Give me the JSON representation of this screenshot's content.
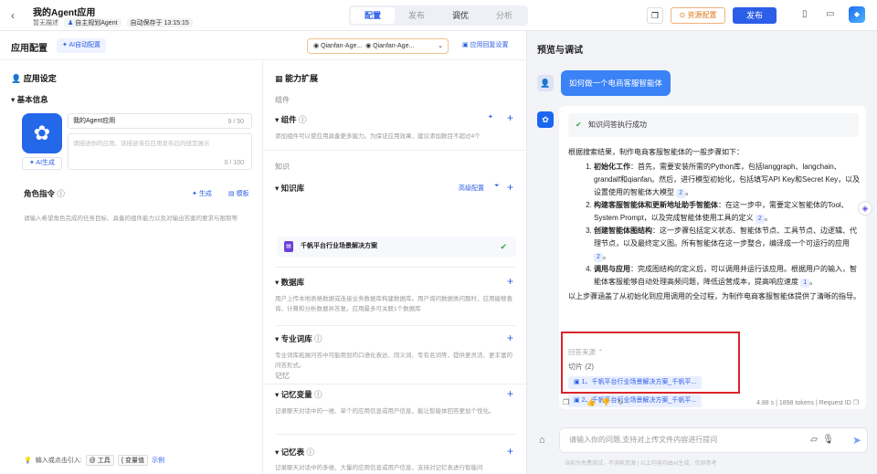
{
  "header": {
    "back_icon": "chevron-left-icon",
    "title": "我的Agent应用",
    "no_desc": "暂无描述",
    "mode": "自主规划Agent",
    "autosave": "自动保存于 13:15:15",
    "tabs": [
      {
        "label": "配置",
        "active": true
      },
      {
        "label": "发布"
      },
      {
        "label": "调优"
      },
      {
        "label": "分析"
      }
    ],
    "resource_btn": "资源配置",
    "publish_btn": "发布",
    "accent": "#2c5ee8"
  },
  "left": {
    "title": "应用配置",
    "ai_config": "AI自动配置",
    "model_a": "Qianfan-Age...",
    "model_b": "Qianfan-Age...",
    "reply_config": "应用回复设置",
    "app_settings": {
      "title": "应用设定",
      "basic_info": "基本信息",
      "name_value": "我的Agent应用",
      "name_count": "9 / 50",
      "desc_placeholder": "请描述你的应用，该描述将在应用发布后的扭定展示",
      "desc_count": "0 / 100",
      "ai_generate": "AI生成"
    },
    "role": {
      "title": "角色指令",
      "generate": "生成",
      "template": "模板",
      "placeholder": "请输入希望角色完成的任务目标、具备的组件能力以及对输出答案的要求与限制等"
    },
    "tip": {
      "text": "输入或点击引入:",
      "tool": "@ 工具",
      "var": "{ 变量值",
      "example": "示例"
    }
  },
  "capability": {
    "title": "能力扩展",
    "components_group": "组件",
    "components": {
      "title": "组件",
      "desc": "添加组件可以使应用具备更多能力。为保证应用效果，建议添加数目不超过4个"
    },
    "knowledge_group": "知识",
    "kb": {
      "title": "知识库",
      "advanced": "高级配置",
      "item": "千帆平台行业场景解决方案"
    },
    "db": {
      "title": "数据库",
      "desc": "用户上传本地表格数据或连接业务数据库构建数据库。用户询问数据类问题时，应用能够查询、计算和分析数据并答复。应用最多可关联1个数据库"
    },
    "terms": {
      "title": "专业词库",
      "desc": "专业词库拓展问答中可能用到的口语化表达、同义词、专有名词等，提供更灵活、更丰富的问答形式。"
    },
    "memory_group": "记忆",
    "mem_var": {
      "title": "记忆变量",
      "desc": "记录聊天对话中的一维、单个的应用信息或用户信息，能让智能体回答更加个性化。"
    },
    "mem_table": {
      "title": "记忆表",
      "desc": "记录聊天对话中的多维、大量的应用信息或用户信息，支持对记忆表进行智能问"
    }
  },
  "preview": {
    "title": "预览与调试",
    "user_message": "如何做一个电商客服智能体",
    "status": "知识问答执行成功",
    "intro": "根据搜索结果，制作电商客服智能体的一般步骤如下：",
    "steps": [
      {
        "head": "初始化工作",
        "body": "：首先，需要安装所需的Python库，包括langgraph、langchain、grandalf和qianfan。然后，进行模型初始化，包括填写API Key和Secret Key，以及设置使用的智能体大模型",
        "ref": "2"
      },
      {
        "head": "构建客服智能体和更新地址助手智能体",
        "body": "：在这一步中，需要定义智能体的Tool、System Prompt，以及完成智能体使用工具的定义",
        "ref": "2"
      },
      {
        "head": "创建智能体图结构",
        "body": "：这一步骤包括定义状态、智能体节点、工具节点、边逻辑、代理节点，以及最终定义图。所有智能体在这一步整合，编译成一个可运行的应用",
        "ref": "2"
      },
      {
        "head": "调用与应用",
        "body": "：完成图结构的定义后，可以调用并运行该应用。根据用户的输入，智能体客服能够自动处理高频问题，降低运营成本，提高响应速度",
        "ref": "1"
      }
    ],
    "summary": "以上步骤涵盖了从初始化到应用调用的全过程，为制作电商客服智能体提供了清晰的指导。",
    "source_label": "回答来源",
    "slices_label": "切片 (2)",
    "slices": [
      "1、千帆平台行业场景解决方案_千帆平...",
      "2、千帆平台行业场景解决方案_千帆平..."
    ],
    "time": "4.88 s",
    "tokens": "1898 tokens",
    "request_id": "Request ID",
    "input_placeholder": "请输入你的问题,支持对上传文件内容进行提问",
    "footer": "当前为免费测试，不消耗资源    |    以上内容均由AI生成，仅供参考"
  }
}
